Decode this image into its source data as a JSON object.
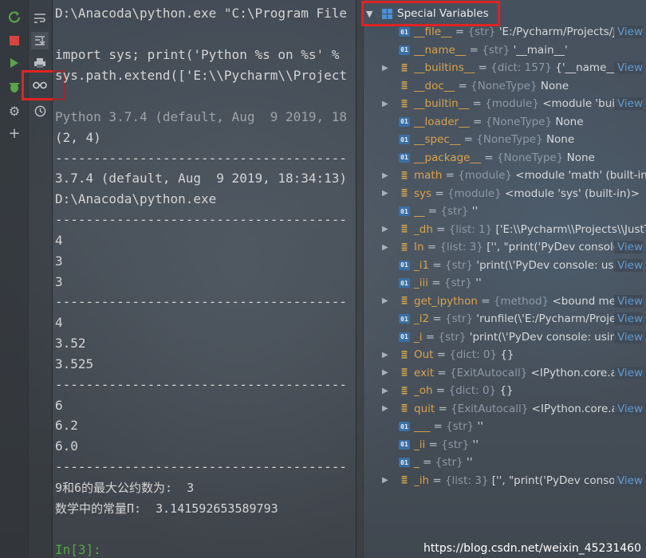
{
  "left_toolbar": {
    "icons": [
      "rerun-icon",
      "stop-icon",
      "run-icon",
      "debug-icon",
      "settings-icon",
      "add-icon"
    ]
  },
  "second_toolbar": {
    "icons": [
      "soft-wrap-icon",
      "scroll-to-end-icon",
      "print-icon",
      "show-variables-icon",
      "history-icon"
    ]
  },
  "console": {
    "lines": [
      "D:\\Anacoda\\python.exe \"C:\\Program File",
      "",
      "import sys; print('Python %s on %s' %",
      "sys.path.extend(['E:\\\\Pycharm\\\\Project",
      "",
      "Python 3.7.4 (default, Aug  9 2019, 18",
      "(2, 4)",
      "--------------------------------------",
      "3.7.4 (default, Aug  9 2019, 18:34:13)",
      "D:\\Anacoda\\python.exe",
      "--------------------------------------",
      "4",
      "3",
      "3",
      "--------------------------------------",
      "4",
      "3.52",
      "3.525",
      "--------------------------------------",
      "6",
      "6.2",
      "6.0",
      "--------------------------------------",
      "9和6的最大公约数为:  3",
      "数学中的常量Π:  3.141592653589793",
      "",
      "In[3]:"
    ]
  },
  "variables": {
    "header": "Special Variables",
    "rows": [
      {
        "expand": false,
        "icon": "01",
        "name": "__file__",
        "type": "{str}",
        "value": "'E:/Pycharm/Projects/J",
        "view": "View"
      },
      {
        "expand": false,
        "icon": "01",
        "name": "__name__",
        "type": "{str}",
        "value": "'__main__'",
        "view": ""
      },
      {
        "expand": true,
        "icon": "obj",
        "name": "__builtins__",
        "type": "{dict: 157}",
        "value": "{'__name__':",
        "view": "View"
      },
      {
        "expand": false,
        "icon": "obj",
        "name": "__doc__",
        "type": "{NoneType}",
        "value": "None",
        "view": ""
      },
      {
        "expand": true,
        "icon": "obj",
        "name": "__builtin__",
        "type": "{module}",
        "value": "<module 'buil",
        "view": "View"
      },
      {
        "expand": false,
        "icon": "01",
        "name": "__loader__",
        "type": "{NoneType}",
        "value": "None",
        "view": ""
      },
      {
        "expand": false,
        "icon": "01",
        "name": "__spec__",
        "type": "{NoneType}",
        "value": "None",
        "view": ""
      },
      {
        "expand": false,
        "icon": "01",
        "name": "__package__",
        "type": "{NoneType}",
        "value": "None",
        "view": ""
      },
      {
        "expand": true,
        "icon": "obj",
        "name": "math",
        "type": "{module}",
        "value": "<module 'math' (built-in)>",
        "view": ""
      },
      {
        "expand": true,
        "icon": "obj",
        "name": "sys",
        "type": "{module}",
        "value": "<module 'sys' (built-in)>",
        "view": ""
      },
      {
        "expand": false,
        "icon": "01",
        "name": "__",
        "type": "{str}",
        "value": "''",
        "view": ""
      },
      {
        "expand": true,
        "icon": "obj",
        "name": "_dh",
        "type": "{list: 1}",
        "value": "['E:\\\\Pycharm\\\\Projects\\\\JustTr",
        "view": ""
      },
      {
        "expand": true,
        "icon": "obj",
        "name": "In",
        "type": "{list: 3}",
        "value": "['', \"print('PyDev console:",
        "view": "View"
      },
      {
        "expand": false,
        "icon": "01",
        "name": "_i1",
        "type": "{str}",
        "value": "'print(\\'PyDev console: usi",
        "view": "View"
      },
      {
        "expand": false,
        "icon": "01",
        "name": "_iii",
        "type": "{str}",
        "value": "''",
        "view": ""
      },
      {
        "expand": true,
        "icon": "obj",
        "name": "get_ipython",
        "type": "{method}",
        "value": "<bound me",
        "view": "View"
      },
      {
        "expand": false,
        "icon": "01",
        "name": "_i2",
        "type": "{str}",
        "value": "'runfile(\\'E:/Pycharm/Proje",
        "view": "View"
      },
      {
        "expand": false,
        "icon": "01",
        "name": "_i",
        "type": "{str}",
        "value": "'print(\\'PyDev console: usin",
        "view": "View"
      },
      {
        "expand": true,
        "icon": "obj",
        "name": "Out",
        "type": "{dict: 0}",
        "value": "{}",
        "view": ""
      },
      {
        "expand": true,
        "icon": "obj",
        "name": "exit",
        "type": "{ExitAutocall}",
        "value": "<IPython.core.a",
        "view": "View"
      },
      {
        "expand": true,
        "icon": "obj",
        "name": "_oh",
        "type": "{dict: 0}",
        "value": "{}",
        "view": ""
      },
      {
        "expand": true,
        "icon": "obj",
        "name": "quit",
        "type": "{ExitAutocall}",
        "value": "<IPython.core.a",
        "view": "View"
      },
      {
        "expand": false,
        "icon": "01",
        "name": "___",
        "type": "{str}",
        "value": "''",
        "view": ""
      },
      {
        "expand": false,
        "icon": "01",
        "name": "_ii",
        "type": "{str}",
        "value": "''",
        "view": ""
      },
      {
        "expand": false,
        "icon": "01",
        "name": "_",
        "type": "{str}",
        "value": "''",
        "view": ""
      },
      {
        "expand": true,
        "icon": "obj",
        "name": "_ih",
        "type": "{list: 3}",
        "value": "['', \"print('PyDev console",
        "view": "View"
      }
    ]
  },
  "watermark": "https://blog.csdn.net/weixin_45231460",
  "colors": {
    "highlight": "#e02323",
    "link": "#5f9bd3",
    "var_name": "#d8a24c"
  }
}
